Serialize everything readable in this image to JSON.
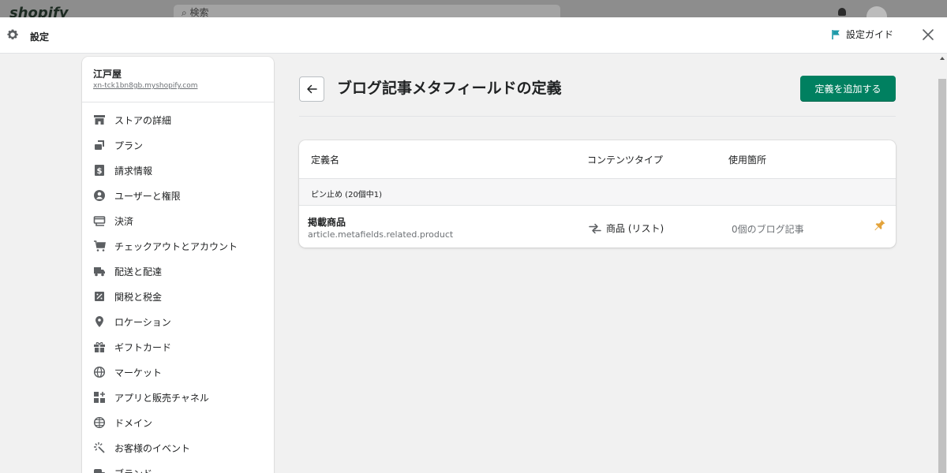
{
  "background": {
    "logo_text": "shopify",
    "search_placeholder": "検索"
  },
  "header": {
    "title": "設定",
    "guide_label": "設定ガイド",
    "icons": {
      "settings": "gear-icon",
      "guide": "flag-icon",
      "close": "close-icon"
    }
  },
  "sidebar": {
    "store_name": "江戸屋",
    "store_url": "xn-tck1bn8gb.myshopify.com",
    "items": [
      {
        "label": "ストアの詳細",
        "icon": "store-icon"
      },
      {
        "label": "プラン",
        "icon": "plan-icon"
      },
      {
        "label": "請求情報",
        "icon": "billing-icon"
      },
      {
        "label": "ユーザーと権限",
        "icon": "user-icon"
      },
      {
        "label": "決済",
        "icon": "payment-icon"
      },
      {
        "label": "チェックアウトとアカウント",
        "icon": "cart-icon"
      },
      {
        "label": "配送と配達",
        "icon": "truck-icon"
      },
      {
        "label": "関税と税金",
        "icon": "tax-icon"
      },
      {
        "label": "ロケーション",
        "icon": "location-icon"
      },
      {
        "label": "ギフトカード",
        "icon": "gift-icon"
      },
      {
        "label": "マーケット",
        "icon": "globe-icon"
      },
      {
        "label": "アプリと販売チャネル",
        "icon": "apps-icon"
      },
      {
        "label": "ドメイン",
        "icon": "domain-icon"
      },
      {
        "label": "お客様のイベント",
        "icon": "events-icon"
      },
      {
        "label": "ブランド",
        "icon": "brand-icon"
      }
    ]
  },
  "main": {
    "title": "ブログ記事メタフィールドの定義",
    "add_button": "定義を追加する",
    "columns": {
      "name": "定義名",
      "content_type": "コンテンツタイプ",
      "usage": "使用箇所"
    },
    "pinned_label": "ピン止め (20個中1)",
    "rows": [
      {
        "name": "掲載商品",
        "key": "article.metafields.related.product",
        "content_type": "商品 (リスト)",
        "usage": "0個のブログ記事"
      }
    ]
  },
  "colors": {
    "primary": "#008060",
    "pin": "#e3a33a",
    "guide_flag": "#1d9aa9"
  }
}
